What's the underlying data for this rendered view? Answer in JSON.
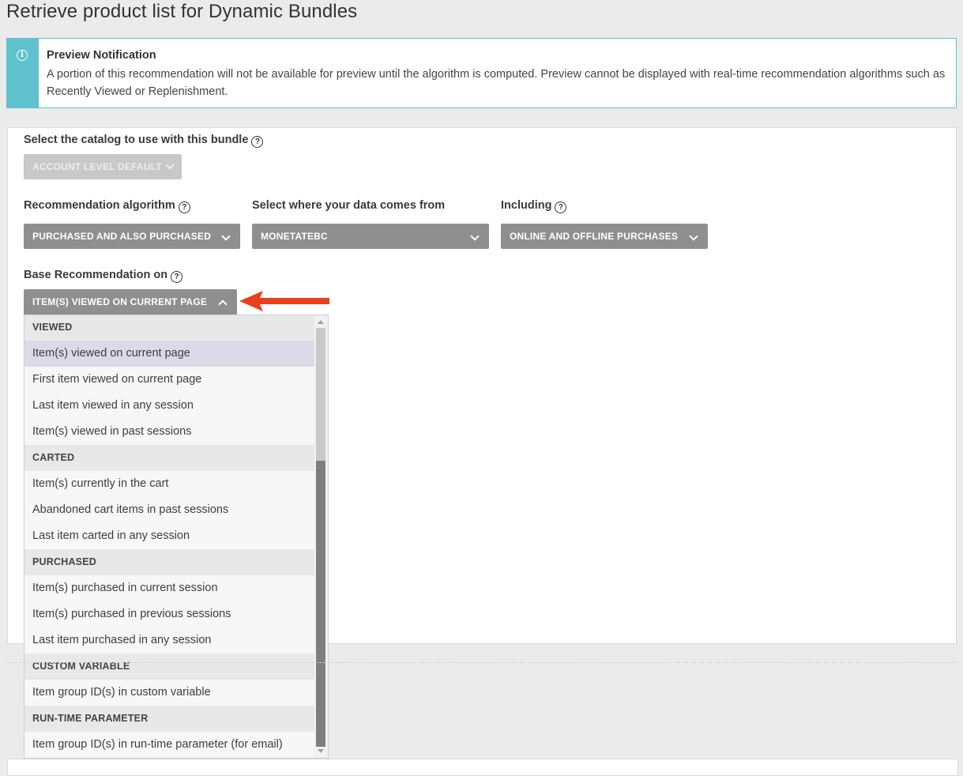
{
  "page": {
    "title": "Retrieve product list for Dynamic Bundles"
  },
  "notice": {
    "icon": "info-icon",
    "title": "Preview Notification",
    "body": "A portion of this recommendation will not be available for preview until the algorithm is computed. Preview cannot be displayed with real-time recommendation algorithms such as Recently Viewed or Replenishment.",
    "accent_color": "#5fc2cc"
  },
  "form": {
    "catalog": {
      "label": "Select the catalog to use with this bundle",
      "value": "ACCOUNT LEVEL DEFAULT"
    },
    "algorithm": {
      "label": "Recommendation algorithm",
      "value": "PURCHASED AND ALSO PURCHASED"
    },
    "data_source": {
      "label": "Select where your data comes from",
      "value": "MONETATEBC"
    },
    "including": {
      "label": "Including",
      "value": "ONLINE AND OFFLINE PURCHASES"
    },
    "base": {
      "label": "Base Recommendation on",
      "value": "ITEM(S) VIEWED ON CURRENT PAGE"
    }
  },
  "dropdown": {
    "groups": [
      {
        "label": "VIEWED",
        "items": [
          "Item(s) viewed on current page",
          "First item viewed on current page",
          "Last item viewed in any session",
          "Item(s) viewed in past sessions"
        ]
      },
      {
        "label": "CARTED",
        "items": [
          "Item(s) currently in the cart",
          "Abandoned cart items in past sessions",
          "Last item carted in any session"
        ]
      },
      {
        "label": "PURCHASED",
        "items": [
          "Item(s) purchased in current session",
          "Item(s) purchased in previous sessions",
          "Last item purchased in any session"
        ]
      },
      {
        "label": "CUSTOM VARIABLE",
        "items": [
          "Item group ID(s) in custom variable"
        ]
      },
      {
        "label": "RUN-TIME PARAMETER",
        "items": [
          "Item group ID(s) in run-time parameter (for email)"
        ]
      }
    ],
    "selected": "Item(s) viewed on current page"
  },
  "colors": {
    "button_bg": "#8f8f8f",
    "selected_bg": "#dcdae8",
    "arrow": "#e8401c"
  }
}
